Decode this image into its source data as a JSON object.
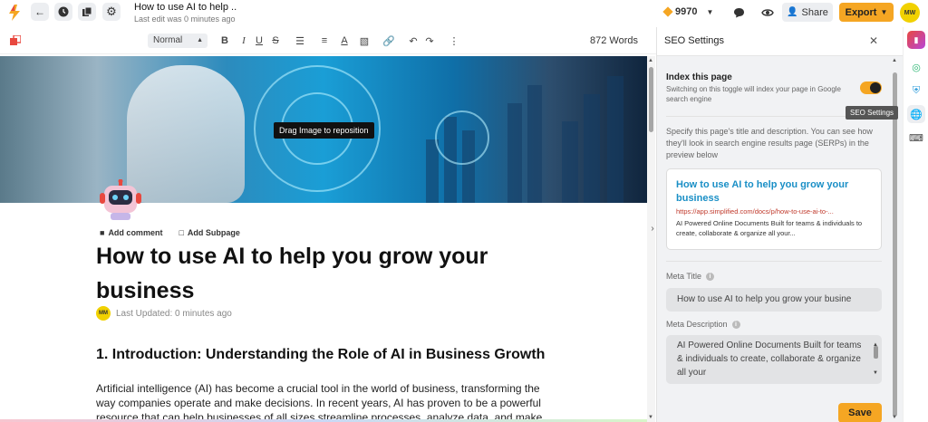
{
  "header": {
    "doc_title": "How to use AI to help ..",
    "last_edit": "Last edit was 0 minutes ago",
    "credits": "9970",
    "share_label": "Share",
    "export_label": "Export",
    "avatar_initials": "MW"
  },
  "toolbar": {
    "text_style": "Normal",
    "word_count": "872 Words",
    "icons": {
      "bold": "B",
      "italic": "I",
      "underline": "U",
      "strike": "S",
      "color": "A"
    }
  },
  "editor": {
    "drag_tooltip": "Drag Image to reposition",
    "add_comment": "Add comment",
    "add_subpage": "Add Subpage",
    "title": "How to use AI to help you grow your business",
    "author_initials": "MM",
    "last_updated": "Last Updated: 0 minutes ago",
    "heading": "1. Introduction: Understanding the Role of AI in Business Growth",
    "paragraph": "Artificial intelligence (AI) has become a crucial tool in the world of business, transforming the way companies operate and make decisions. In recent years, AI has proven to be a powerful resource that can help businesses of all sizes streamline processes, analyze data, and make more informed strategic"
  },
  "seo_panel": {
    "title": "SEO Settings",
    "index_title": "Index this page",
    "index_desc": "Switching on this toggle will index your page in Google search engine",
    "index_enabled": true,
    "spec_text": "Specify this page's title and description. You can see how they'll look in search engine results page (SERPs) in the preview below",
    "preview": {
      "title": "How to use AI to help you grow your business",
      "url": "https://app.simplified.com/docs/p/how-to-use-ai-to-...",
      "desc": "AI Powered Online Documents Built for teams & individuals to create, collaborate & organize all your..."
    },
    "meta_title_label": "Meta Title",
    "meta_title_value": "How to use AI to help you grow your busine",
    "meta_desc_label": "Meta Description",
    "meta_desc_value": "AI Powered Online Documents Built for teams & individuals to create, collaborate & organize all your",
    "save_label": "Save"
  },
  "rail": {
    "tooltip": "SEO Settings"
  },
  "colors": {
    "accent": "#f5a623",
    "link": "#1a8fc6",
    "url": "#c0392b"
  }
}
